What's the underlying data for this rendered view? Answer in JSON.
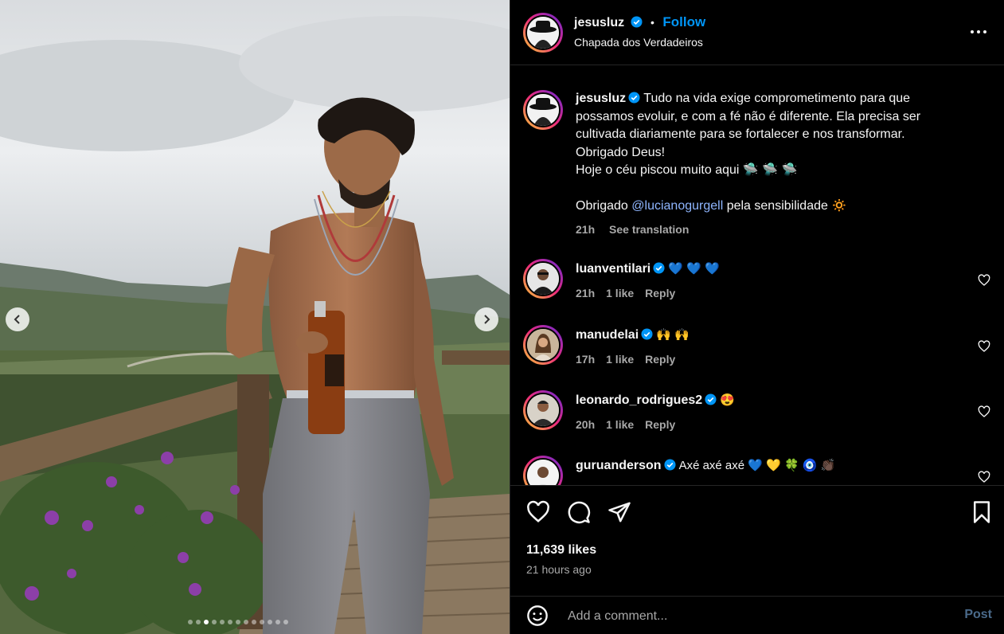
{
  "post": {
    "username": "jesusluz",
    "follow_label": "Follow",
    "separator": "•",
    "location": "Chapada dos Verdadeiros"
  },
  "caption": {
    "username": "jesusluz",
    "text_lines": [
      "Tudo na vida exige comprometimento para que",
      "possamos evoluir, e com a fé não é diferente. Ela precisa ser",
      "cultivada diariamente para se fortalecer e nos transformar.",
      "Obrigado Deus!",
      "Hoje o céu piscou muito aqui 🛸 🛸 🛸"
    ],
    "thanks_prefix": "Obrigado ",
    "mention": "@lucianogurgell",
    "thanks_suffix": " pela sensibilidade 🔅",
    "time": "21h",
    "see_translation": "See translation"
  },
  "comments": [
    {
      "username": "luanventilari",
      "text": "💙 💙 💙",
      "time": "21h",
      "likes": "1 like",
      "reply": "Reply"
    },
    {
      "username": "manudelai",
      "text": "🙌 🙌",
      "time": "17h",
      "likes": "1 like",
      "reply": "Reply"
    },
    {
      "username": "leonardo_rodrigues2",
      "text": "😍",
      "time": "20h",
      "likes": "1 like",
      "reply": "Reply"
    },
    {
      "username": "guruanderson",
      "text": "Axé axé axé 💙 💛 🍀 🧿 👏🏿",
      "time": "",
      "likes": "",
      "reply": ""
    }
  ],
  "stats": {
    "likes": "11,639 likes",
    "time_ago": "21 hours ago"
  },
  "composer": {
    "placeholder": "Add a comment...",
    "post_label": "Post"
  },
  "carousel": {
    "slide_count": 13,
    "active_index": 2
  },
  "colors": {
    "accent": "#0095f6",
    "background": "#000000",
    "muted_text": "#a8a8a8",
    "verified": "#0095f6"
  }
}
